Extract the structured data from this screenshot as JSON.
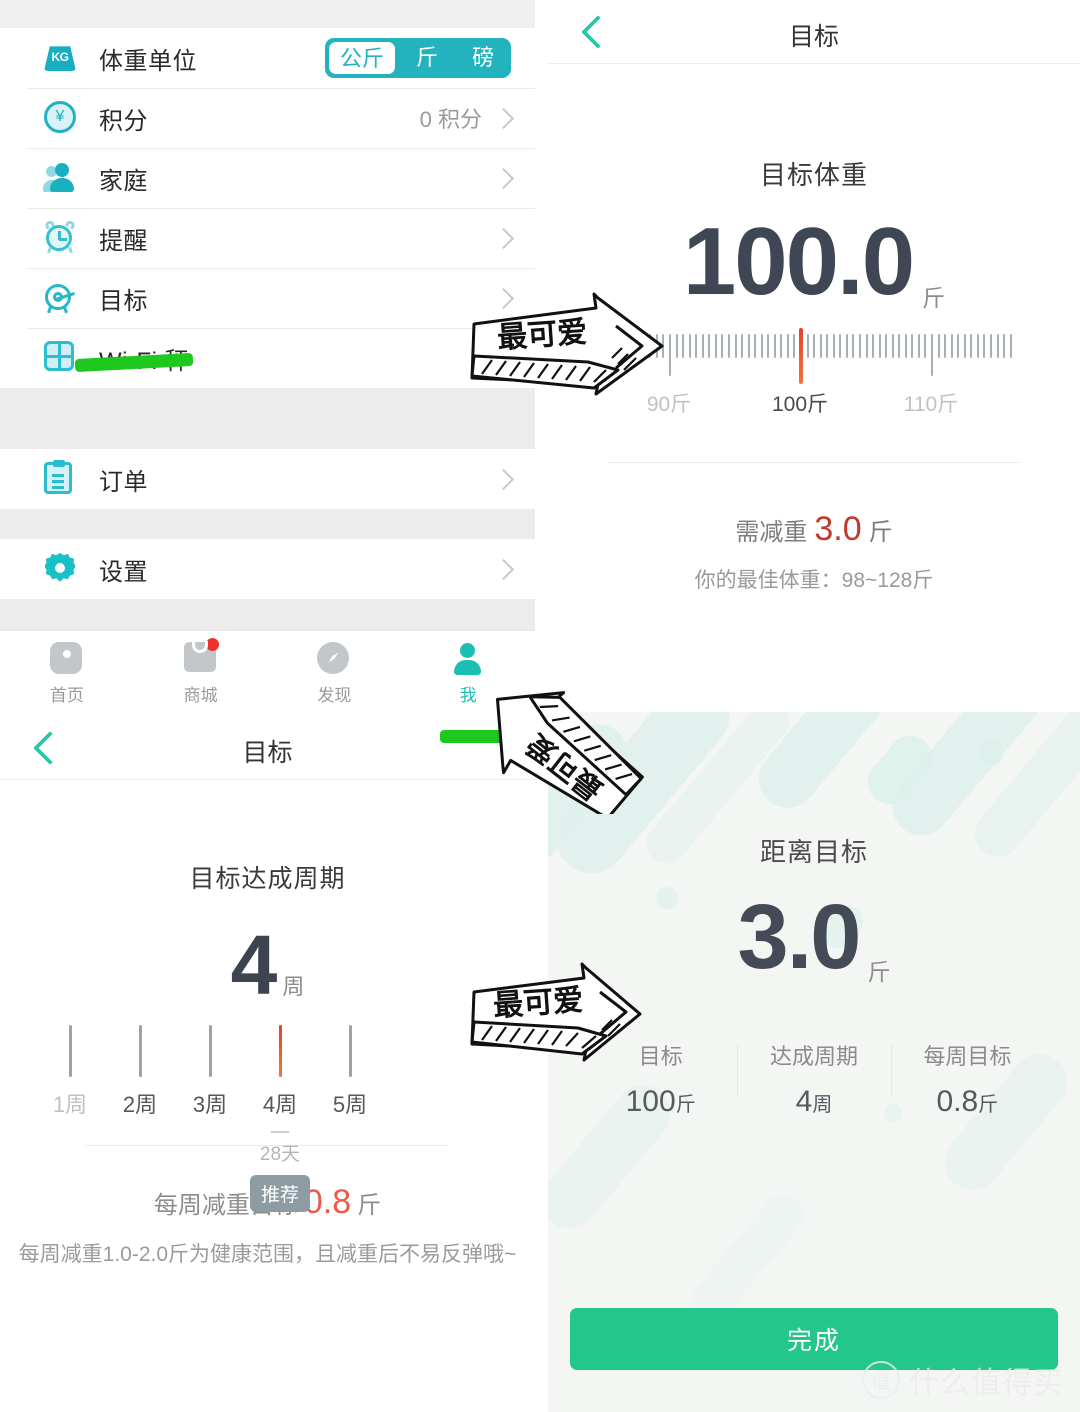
{
  "settings": {
    "rows": [
      {
        "icon": "weight-kg-icon",
        "label": "体重单位",
        "type": "segment"
      },
      {
        "icon": "coin-icon",
        "label": "积分",
        "value": "0 积分",
        "type": "chevron"
      },
      {
        "icon": "family-icon",
        "label": "家庭",
        "value": "",
        "type": "chevron"
      },
      {
        "icon": "alarm-icon",
        "label": "提醒",
        "value": "",
        "type": "chevron"
      },
      {
        "icon": "target-icon",
        "label": "目标",
        "value": "",
        "type": "chevron"
      },
      {
        "icon": "wifi-scale-icon",
        "label": "Wi-Fi 秤",
        "value": "",
        "type": "chevron"
      }
    ],
    "unit_segment": {
      "options": [
        "公斤",
        "斤",
        "磅"
      ],
      "selected": "公斤"
    },
    "orders": {
      "icon": "clipboard-icon",
      "label": "订单"
    },
    "settings_row": {
      "icon": "gear-icon",
      "label": "设置"
    }
  },
  "tabbar": {
    "items": [
      {
        "label": "首页",
        "icon": "home-icon",
        "active": false,
        "badge": false
      },
      {
        "label": "商城",
        "icon": "shop-icon",
        "active": false,
        "badge": true
      },
      {
        "label": "发现",
        "icon": "compass-icon",
        "active": false,
        "badge": false
      },
      {
        "label": "我",
        "icon": "profile-icon",
        "active": true,
        "badge": false
      }
    ]
  },
  "target_weight_screen": {
    "nav_title": "目标",
    "heading": "目标体重",
    "value": "100.0",
    "unit": "斤",
    "ruler": {
      "labels": [
        {
          "text": "90斤",
          "pos": 90,
          "current": false
        },
        {
          "text": "100斤",
          "pos": 100,
          "current": true
        },
        {
          "text": "110斤",
          "pos": 110,
          "current": false
        }
      ],
      "min": 88,
      "max": 116,
      "cursor": 100,
      "step": 0.5
    },
    "need_lose_prefix": "需减重",
    "need_lose_value": "3.0",
    "need_lose_unit": "斤",
    "best_range": "你的最佳体重：98~128斤"
  },
  "goal_cycle_screen": {
    "nav_title": "目标",
    "heading": "目标达成周期",
    "value": "4",
    "unit": "周",
    "weeks": [
      {
        "label": "1周",
        "selected": false,
        "dim": true
      },
      {
        "label": "2周",
        "selected": false,
        "dim": false
      },
      {
        "label": "3周",
        "selected": false,
        "dim": false
      },
      {
        "label": "4周",
        "selected": true,
        "dim": false,
        "sub": "28天",
        "badge": "推荐"
      },
      {
        "label": "5周",
        "selected": false,
        "dim": false
      }
    ],
    "weekly_goal_prefix": "每周减重目标",
    "weekly_goal_value": "0.8",
    "weekly_goal_unit": "斤",
    "tip": "每周减重1.0-2.0斤为健康范围，且减重后不易反弹哦~"
  },
  "result_screen": {
    "heading": "距离目标",
    "value": "3.0",
    "unit": "斤",
    "stats": [
      {
        "key": "目标",
        "value": "100",
        "value_unit": "斤"
      },
      {
        "key": "达成周期",
        "value": "4",
        "value_unit": "周"
      },
      {
        "key": "每周目标",
        "value": "0.8",
        "value_unit": "斤"
      }
    ],
    "done_button": "完成"
  },
  "annotations": {
    "arrows": [
      {
        "text": "最可爱",
        "direction": "right"
      },
      {
        "text": "最可爱",
        "direction": "down-left"
      },
      {
        "text": "最可爱",
        "direction": "right"
      }
    ]
  },
  "watermark": {
    "logo": "值",
    "text": "什么值得买"
  },
  "colors": {
    "teal": "#23b3bf",
    "accent_green": "#23c68b",
    "marker_green": "#1ec81e",
    "cursor_orange": "#e8402a",
    "red_text": "#c0392b"
  }
}
